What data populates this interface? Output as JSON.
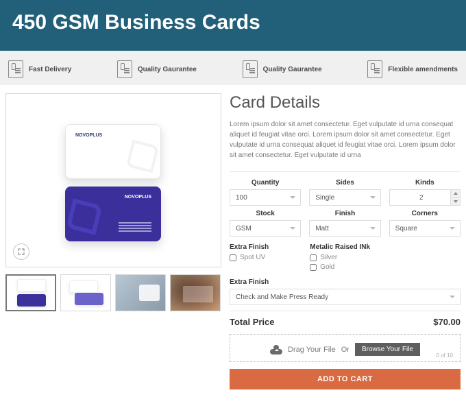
{
  "hero": {
    "title": "450 GSM Business Cards"
  },
  "features": [
    {
      "label": "Fast Delivery"
    },
    {
      "label": "Quality Gaurantee"
    },
    {
      "label": "Quality Gaurantee"
    },
    {
      "label": "Flexible amendments"
    }
  ],
  "details": {
    "heading": "Card Details",
    "description": "Lorem ipsum dolor sit amet consectetur. Eget vulputate id urna consequat aliquet id feugiat vitae orci. Lorem ipsum dolor sit amet consectetur. Eget vulputate id urna consequat aliquet id feugiat vitae orci. Lorem ipsum dolor sit amet consectetur. Eget vulputate id urna"
  },
  "options": {
    "quantity": {
      "label": "Quantity",
      "value": "100"
    },
    "sides": {
      "label": "Sides",
      "value": "Single"
    },
    "kinds": {
      "label": "Kinds",
      "value": "2"
    },
    "stock": {
      "label": "Stock",
      "value": "GSM"
    },
    "finish": {
      "label": "Finish",
      "value": "Matt"
    },
    "corners": {
      "label": "Corners",
      "value": "Square"
    }
  },
  "extraFinish": {
    "heading": "Extra Finish",
    "options": [
      "Spot UV"
    ]
  },
  "metallicInk": {
    "heading": "Metalic Raised INk",
    "options": [
      "Silver",
      "Gold"
    ]
  },
  "extraFinish2": {
    "heading": "Extra Finish",
    "value": "Check and Make Press Ready"
  },
  "total": {
    "label": "Total Price",
    "value": "$70.00"
  },
  "upload": {
    "dragText": "Drag Your File",
    "orText": "Or",
    "browse": "Browse Your File",
    "counter": "0 of 10"
  },
  "cta": {
    "addToCart": "ADD TO CART"
  }
}
